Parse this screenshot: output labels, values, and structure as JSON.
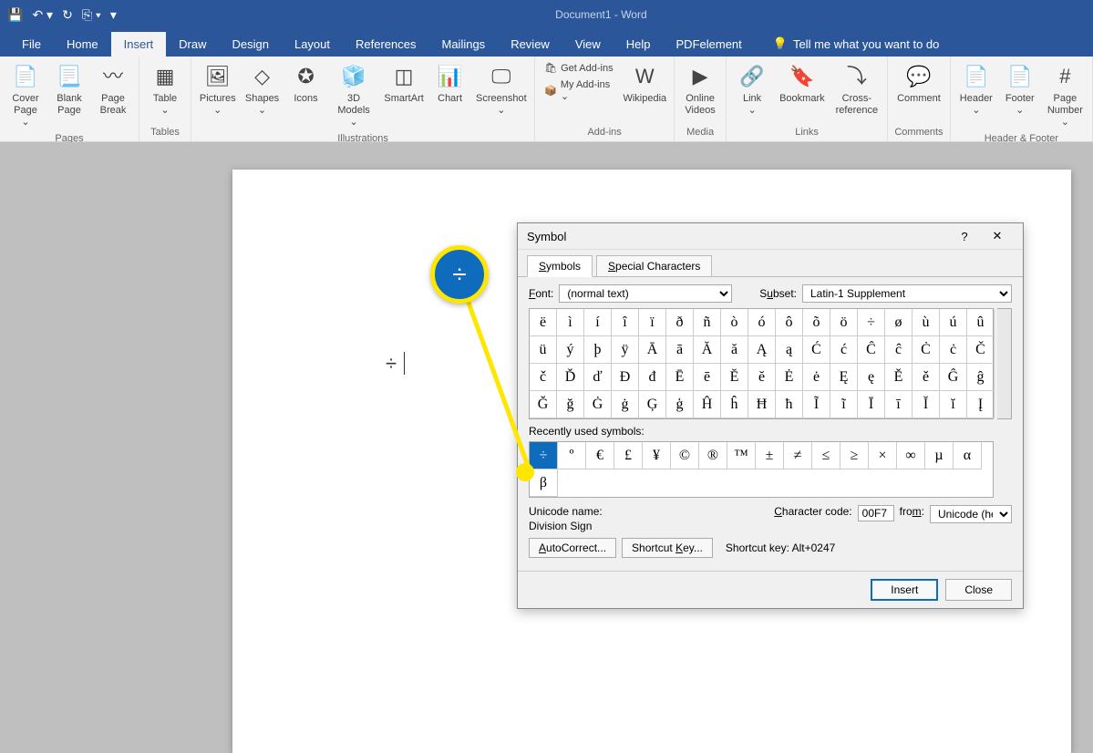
{
  "app": {
    "title": "Document1  -  Word"
  },
  "qat": [
    "save",
    "undo",
    "redo",
    "repeat",
    "customize"
  ],
  "tabs": [
    "File",
    "Home",
    "Insert",
    "Draw",
    "Design",
    "Layout",
    "References",
    "Mailings",
    "Review",
    "View",
    "Help",
    "PDFelement"
  ],
  "active_tab": "Insert",
  "tellme": "Tell me what you want to do",
  "ribbon": {
    "pages": {
      "label": "Pages",
      "items": [
        {
          "l": "Cover\nPage ⌄"
        },
        {
          "l": "Blank\nPage"
        },
        {
          "l": "Page\nBreak"
        }
      ]
    },
    "tables": {
      "label": "Tables",
      "items": [
        {
          "l": "Table\n⌄"
        }
      ]
    },
    "illus": {
      "label": "Illustrations",
      "items": [
        {
          "l": "Pictures\n⌄"
        },
        {
          "l": "Shapes\n⌄"
        },
        {
          "l": "Icons"
        },
        {
          "l": "3D\nModels ⌄"
        },
        {
          "l": "SmartArt"
        },
        {
          "l": "Chart"
        },
        {
          "l": "Screenshot\n⌄"
        }
      ]
    },
    "addins": {
      "label": "Add-ins",
      "items": [
        {
          "l": "Get Add-ins"
        },
        {
          "l": "My Add-ins ⌄"
        },
        {
          "l": "Wikipedia"
        }
      ]
    },
    "media": {
      "label": "Media",
      "items": [
        {
          "l": "Online\nVideos"
        }
      ]
    },
    "links": {
      "label": "Links",
      "items": [
        {
          "l": "Link\n⌄"
        },
        {
          "l": "Bookmark"
        },
        {
          "l": "Cross-\nreference"
        }
      ]
    },
    "comments": {
      "label": "Comments",
      "items": [
        {
          "l": "Comment"
        }
      ]
    },
    "hf": {
      "label": "Header & Footer",
      "items": [
        {
          "l": "Header\n⌄"
        },
        {
          "l": "Footer\n⌄"
        },
        {
          "l": "Page\nNumber ⌄"
        }
      ]
    }
  },
  "doc": {
    "content": "÷"
  },
  "dialog": {
    "title": "Symbol",
    "tabs": [
      "Symbols",
      "Special Characters"
    ],
    "font_label": "Font:",
    "font_value": "(normal text)",
    "subset_label": "Subset:",
    "subset_value": "Latin-1 Supplement",
    "grid": [
      [
        "ë",
        "ì",
        "í",
        "î",
        "ï",
        "ð",
        "ñ",
        "ò",
        "ó",
        "ô",
        "õ",
        "ö",
        "÷",
        "ø",
        "ù",
        "ú",
        "û"
      ],
      [
        "ü",
        "ý",
        "þ",
        "ÿ",
        "Ā",
        "ā",
        "Ă",
        "ă",
        "Ą",
        "ą",
        "Ć",
        "ć",
        "Ĉ",
        "ĉ",
        "Ċ",
        "ċ",
        "Č"
      ],
      [
        "č",
        "Ď",
        "ď",
        "Đ",
        "đ",
        "Ē",
        "ē",
        "Ĕ",
        "ĕ",
        "Ė",
        "ė",
        "Ę",
        "ę",
        "Ě",
        "ě",
        "Ĝ",
        "ĝ"
      ],
      [
        "Ğ",
        "ğ",
        "Ġ",
        "ġ",
        "Ģ",
        "ģ",
        "Ĥ",
        "ĥ",
        "Ħ",
        "ħ",
        "Ĩ",
        "ĩ",
        "Ī",
        "ī",
        "Ĭ",
        "ĭ",
        "Į"
      ]
    ],
    "recent_label": "Recently used symbols:",
    "recent": [
      "÷",
      "º",
      "€",
      "£",
      "¥",
      "©",
      "®",
      "™",
      "±",
      "≠",
      "≤",
      "≥",
      "×",
      "∞",
      "µ",
      "α",
      "β"
    ],
    "selected": "÷",
    "unicode_label": "Unicode name:",
    "unicode_name": "Division Sign",
    "charcode_label": "Character code:",
    "charcode": "00F7",
    "from_label": "from:",
    "from_value": "Unicode (hex)",
    "autocorrect": "AutoCorrect...",
    "shortcutkey_btn": "Shortcut Key...",
    "shortcut_label": "Shortcut key: Alt+0247",
    "insert": "Insert",
    "close": "Close",
    "help": "?",
    "x": "✕"
  },
  "callout": "÷"
}
